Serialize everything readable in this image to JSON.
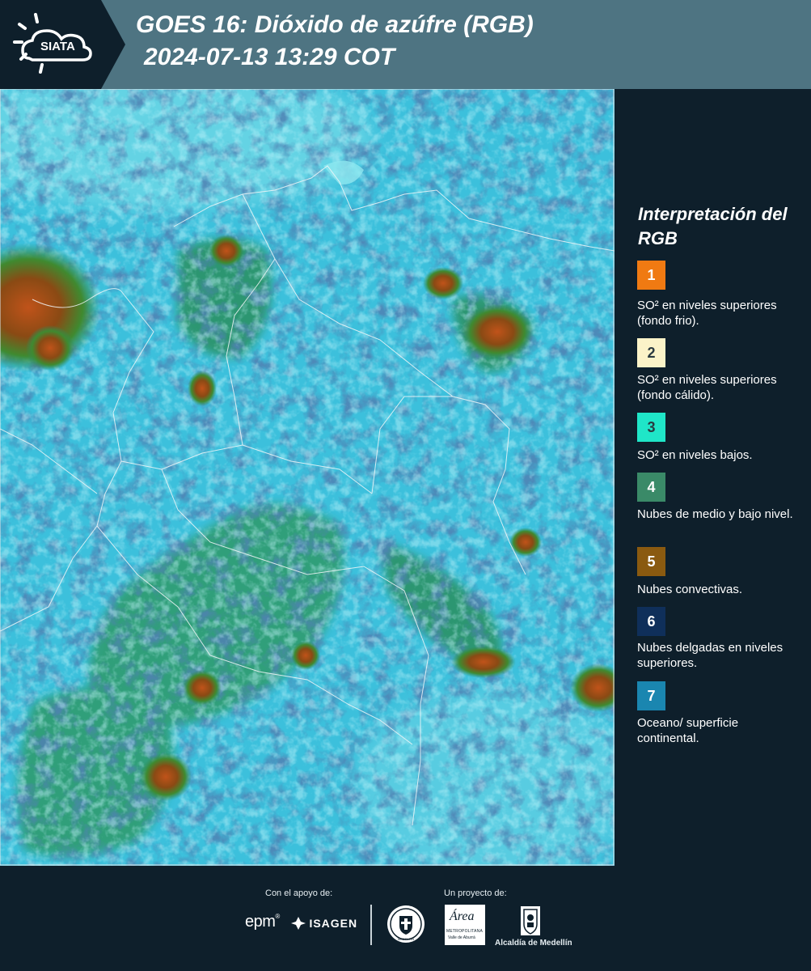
{
  "header": {
    "logo_text": "SIATA",
    "title_line1": "GOES 16: Dióxido de azúfre (RGB)",
    "title_line2": "2024-07-13 13:29 COT"
  },
  "map": {
    "icon": "satellite-rgb-map",
    "colors": {
      "ocean_surface": "#35b4d6",
      "low_so2": "#22d6c8",
      "mid_low_clouds": "#2e8a5c",
      "convective": "#8a4a10",
      "thin_high_clouds": "#14356e",
      "cold_so2": "#f07a10"
    }
  },
  "legend": {
    "title": "Interpretación del RGB",
    "items": [
      {
        "number": "1",
        "color": "#f07a12",
        "label": "SO² en niveles superiores (fondo frio)."
      },
      {
        "number": "2",
        "color": "#fbf3c8",
        "label": "SO² en niveles superiores (fondo cálido)."
      },
      {
        "number": "3",
        "color": "#1fe6c8",
        "label": "SO² en niveles bajos."
      },
      {
        "number": "4",
        "color": "#3a8a68",
        "label": "Nubes de medio y bajo nivel."
      },
      {
        "number": "5",
        "color": "#8a5a10",
        "label": "Nubes convectivas."
      },
      {
        "number": "6",
        "color": "#0f2f5a",
        "label": "Nubes delgadas en niveles superiores."
      },
      {
        "number": "7",
        "color": "#1a86b0",
        "label": "Oceano/ superficie continental."
      }
    ]
  },
  "footer": {
    "support_label": "Con el apoyo de:",
    "project_label": "Un proyecto de:",
    "epm_logo": "epm",
    "isagen_logo": "ISAGEN",
    "metropolitana_logo_line1": "Área",
    "metropolitana_logo_line2": "METROPOLITANA",
    "metropolitana_logo_line3": "Valle de Aburrá",
    "alcaldia_label": "Alcaldía de Medellín",
    "medellin_seal": "MEDELLIN"
  }
}
